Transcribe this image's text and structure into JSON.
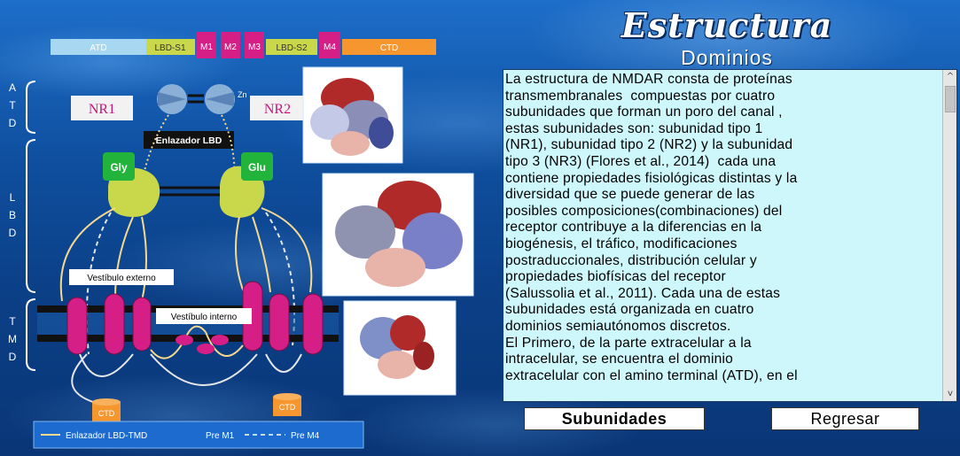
{
  "header": {
    "title": "Estructura",
    "subtitle": "Dominios"
  },
  "diagram": {
    "domain_bar": [
      "ATD",
      "LBD-S1",
      "M1",
      "M2",
      "M3",
      "LBD-S2",
      "M4",
      "CTD"
    ],
    "side_labels": {
      "atd": [
        "A",
        "T",
        "D"
      ],
      "lbd": [
        "L",
        "B",
        "D"
      ],
      "tmd": [
        "T",
        "M",
        "D"
      ]
    },
    "subunits": [
      "NR1",
      "NR2"
    ],
    "zn_label": "Zn",
    "linker_label": "Enlazador LBD",
    "ligands": [
      "Gly",
      "Glu"
    ],
    "vestibule_external": "Vestíbulo externo",
    "vestibule_internal": "Vestíbulo interno",
    "ctd_labels": [
      "CTD",
      "CTD"
    ],
    "legend": {
      "linker": "Enlazador LBD-TMD",
      "pre_m1": "Pre M1",
      "pre_m4": "Pre M4"
    },
    "colors": {
      "atd": "#a8d7f2",
      "lbd": "#c8d84a",
      "tm": "#d61f86",
      "ctd": "#f5962f",
      "nr_label": "#c8157a"
    }
  },
  "text_panel": {
    "content": "La estructura de NMDAR consta de proteínas\ntransmembranales  compuestas por cuatro\nsubunidades que forman un poro del canal ,\nestas subunidades son: subunidad tipo 1\n(NR1), subunidad tipo 2 (NR2) y la subunidad\ntipo 3 (NR3) (Flores et al., 2014)  cada una\ncontiene propiedades fisiológicas distintas y la\ndiversidad que se puede generar de las\nposibles composiciones(combinaciones) del\nreceptor contribuye a la diferencias en la\nbiogénesis, el tráfico, modificaciones\npostraduccionales, distribución celular y\npropiedades biofísicas del receptor\n(Salussolia et al., 2011). Cada una de estas\nsubunidades está organizada en cuatro\ndominios semiautónomos discretos.\nEl Primero, de la parte extracelular a la\nintracelular, se encuentra el dominio\nextracelular con el amino terminal (ATD), en el",
    "scroll_up": "^",
    "scroll_down": "v"
  },
  "buttons": {
    "subunidades": "Subunidades",
    "regresar": "Regresar"
  }
}
